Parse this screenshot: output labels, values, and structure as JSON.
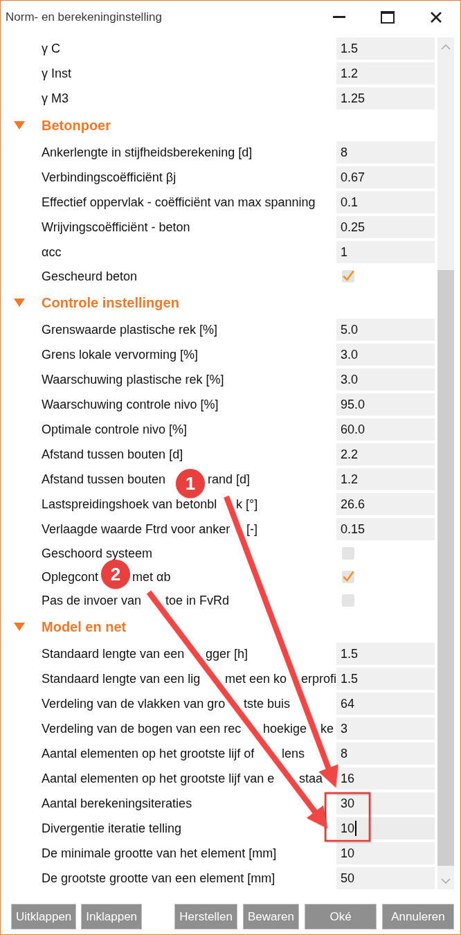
{
  "window": {
    "title": "Norm- en berekeninginstelling"
  },
  "sections": [
    {
      "rows": [
        {
          "kind": "field",
          "label": "γ C",
          "value": "1.5",
          "focused": false
        },
        {
          "kind": "field",
          "label": "γ Inst",
          "value": "1.2",
          "focused": false
        },
        {
          "kind": "field",
          "label": "γ M3",
          "value": "1.25",
          "focused": false
        }
      ]
    },
    {
      "title": "Betonpoer",
      "expanded": true,
      "rows": [
        {
          "kind": "field",
          "label": "Ankerlengte in stijfheidsberekening [d]",
          "value": "8",
          "focused": false
        },
        {
          "kind": "field",
          "label": "Verbindingscoëfficiënt βj",
          "value": "0.67",
          "focused": false
        },
        {
          "kind": "field",
          "label": "Effectief oppervlak - coëfficiënt van max spanning",
          "value": "0.1",
          "focused": false
        },
        {
          "kind": "field",
          "label": "Wrijvingscoëfficiënt - beton",
          "value": "0.25",
          "focused": false
        },
        {
          "kind": "field",
          "label": "αcc",
          "value": "1",
          "focused": false
        },
        {
          "kind": "checkbox",
          "label": "Gescheurd beton",
          "checked": true
        }
      ]
    },
    {
      "title": "Controle instellingen",
      "expanded": true,
      "rows": [
        {
          "kind": "field",
          "label": "Grenswaarde plastische rek [%]",
          "value": "5.0",
          "focused": false
        },
        {
          "kind": "field",
          "label": "Grens lokale vervorming [%]",
          "value": "3.0",
          "focused": false
        },
        {
          "kind": "field",
          "label": "Waarschuwing plastische rek [%]",
          "value": "3.0",
          "focused": false
        },
        {
          "kind": "field",
          "label": "Waarschuwing controle nivo [%]",
          "value": "95.0",
          "focused": false
        },
        {
          "kind": "field",
          "label": "Optimale controle nivo [%]",
          "value": "60.0",
          "focused": false
        },
        {
          "kind": "field",
          "label": "Afstand tussen bouten [d]",
          "value": "2.2",
          "focused": false
        },
        {
          "kind": "field",
          "label_parts": [
            "Afstand tussen bouten",
            "rand [d]"
          ],
          "value": "1.2",
          "focused": false
        },
        {
          "kind": "field",
          "label_parts": [
            "Lastspreidingshoek van betonbl",
            "k [°]"
          ],
          "value": "26.6",
          "focused": false
        },
        {
          "kind": "field",
          "label_parts": [
            "Verlaagde waarde Ftrd voor anker",
            "[-]"
          ],
          "value": "0.15",
          "focused": false
        },
        {
          "kind": "checkbox",
          "label": "Geschoord systeem",
          "checked": false
        },
        {
          "kind": "checkbox",
          "label_parts": [
            "Oplegcont",
            "met αb"
          ],
          "checked": true
        },
        {
          "kind": "checkbox",
          "label_parts": [
            "Pas de invoer van",
            "toe in FvRd"
          ],
          "checked": false
        }
      ]
    },
    {
      "title": "Model en net",
      "expanded": true,
      "rows": [
        {
          "kind": "field",
          "label_parts": [
            "Standaard lengte van een",
            "gger [h]"
          ],
          "value": "1.5",
          "focused": false
        },
        {
          "kind": "field",
          "label_parts": [
            "Standaard lengte van een lig",
            "met een ko",
            "erprofi"
          ],
          "value": "1.5",
          "focused": false
        },
        {
          "kind": "field",
          "label_parts": [
            "Verdeling van de vlakken van gro",
            "tste buis"
          ],
          "value": "64",
          "focused": false
        },
        {
          "kind": "field",
          "label_parts": [
            "Verdeling van de bogen van een rec",
            "hoekige",
            "ke"
          ],
          "value": "3",
          "focused": false
        },
        {
          "kind": "field",
          "label_parts": [
            "Aantal elementen op het grootste lijf of",
            "lens"
          ],
          "value": "8",
          "focused": false
        },
        {
          "kind": "field",
          "label_parts": [
            "Aantal elementen op het grootste lijf van e",
            "staa"
          ],
          "value": "16",
          "focused": false
        },
        {
          "kind": "field",
          "label": "Aantal berekeningsiteraties",
          "value": "30",
          "focused": false
        },
        {
          "kind": "field",
          "label": "Divergentie iteratie telling",
          "value": "10",
          "focused": true
        },
        {
          "kind": "field",
          "label": "De minimale grootte van het element [mm]",
          "value": "10",
          "focused": false
        },
        {
          "kind": "field",
          "label": "De grootste grootte van een element [mm]",
          "value": "50",
          "focused": false
        }
      ]
    }
  ],
  "buttons": {
    "left": [
      {
        "label": "Uitklappen"
      },
      {
        "label": "Inklappen"
      }
    ],
    "right": [
      {
        "label": "Herstellen"
      },
      {
        "label": "Bewaren"
      },
      {
        "label": "Oké"
      },
      {
        "label": "Annuleren"
      }
    ]
  },
  "annotations": {
    "markers": [
      {
        "number": "1"
      },
      {
        "number": "2"
      }
    ]
  }
}
